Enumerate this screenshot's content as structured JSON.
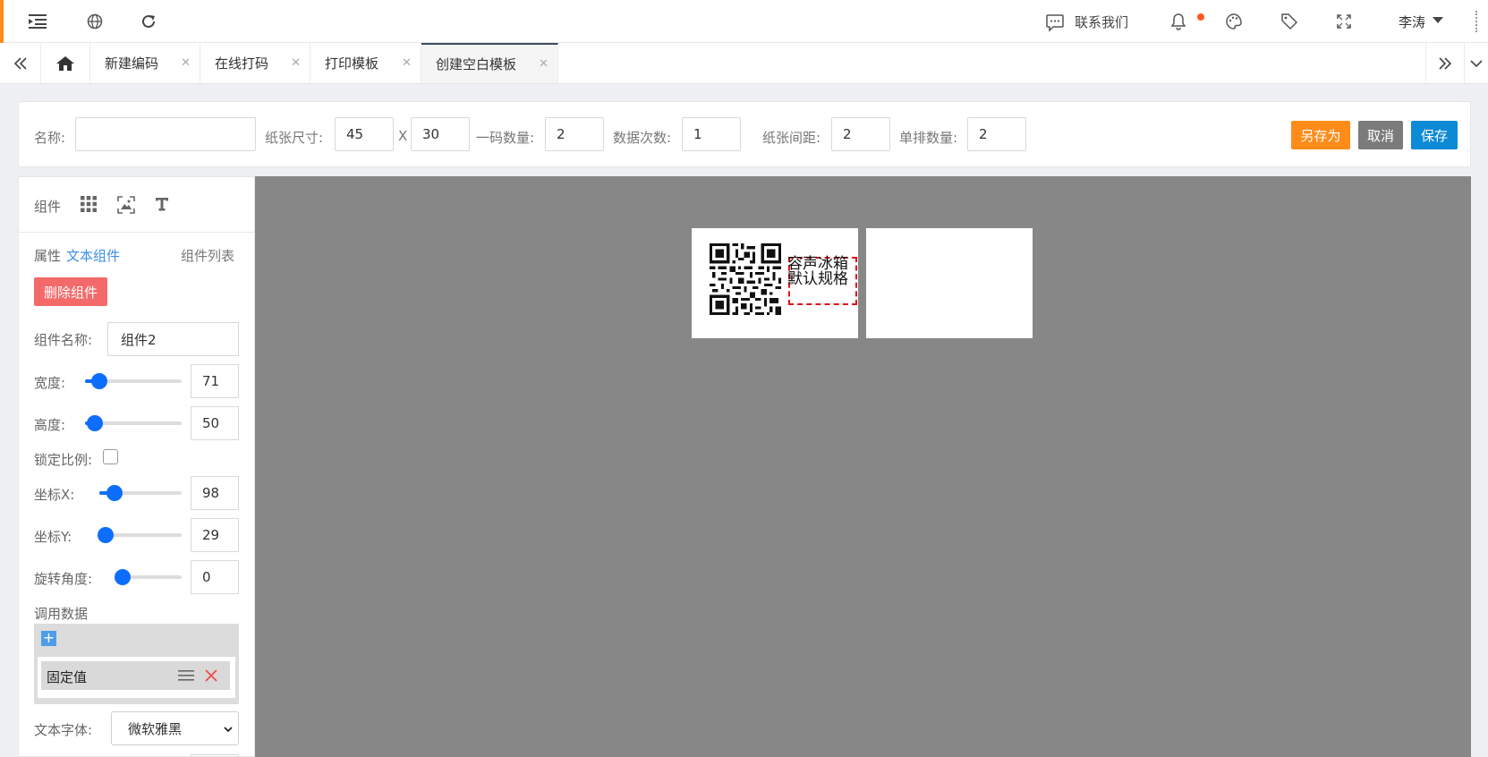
{
  "topbar": {
    "contact_label": "联系我们",
    "user_name": "李涛",
    "icons": [
      "menu-icon",
      "globe-icon",
      "refresh-icon",
      "chat-icon",
      "bell-icon",
      "palette-icon",
      "tag-icon",
      "fullscreen-icon",
      "caret-down-icon"
    ],
    "notify_color": "#ff5a1f"
  },
  "tabs": [
    {
      "label": "新建编码"
    },
    {
      "label": "在线打码"
    },
    {
      "label": "打印模板"
    },
    {
      "label": "创建空白模板"
    }
  ],
  "toolbar": {
    "name_label": "名称:",
    "name_value": "",
    "paper_size_label": "纸张尺寸:",
    "paper_width": "45",
    "size_sep": "X",
    "paper_height": "30",
    "per_code_label": "一码数量:",
    "per_code_value": "2",
    "data_times_label": "数据次数:",
    "data_times_value": "1",
    "gap_label": "纸张间距:",
    "gap_value": "2",
    "per_row_label": "单排数量:",
    "per_row_value": "2",
    "save_as_label": "另存为",
    "cancel_label": "取消",
    "save_label": "保存"
  },
  "sidebar": {
    "components_label": "组件",
    "props_label": "属性",
    "component_type": "文本组件",
    "component_list_label": "组件列表",
    "delete_label": "删除组件",
    "name_label": "组件名称:",
    "name_value": "组件2",
    "width_label": "宽度:",
    "width_value": "71",
    "height_label": "高度:",
    "height_value": "50",
    "lock_ratio_label": "锁定比例:",
    "x_label": "坐标X:",
    "x_value": "98",
    "y_label": "坐标Y:",
    "y_value": "29",
    "rotate_label": "旋转角度:",
    "rotate_value": "0",
    "data_label": "调用数据",
    "data_item": "固定值",
    "font_label": "文本字体:",
    "font_value": "微软雅黑"
  },
  "canvas": {
    "text_line1": "容声冰箱",
    "text_line2": "默认规格"
  }
}
